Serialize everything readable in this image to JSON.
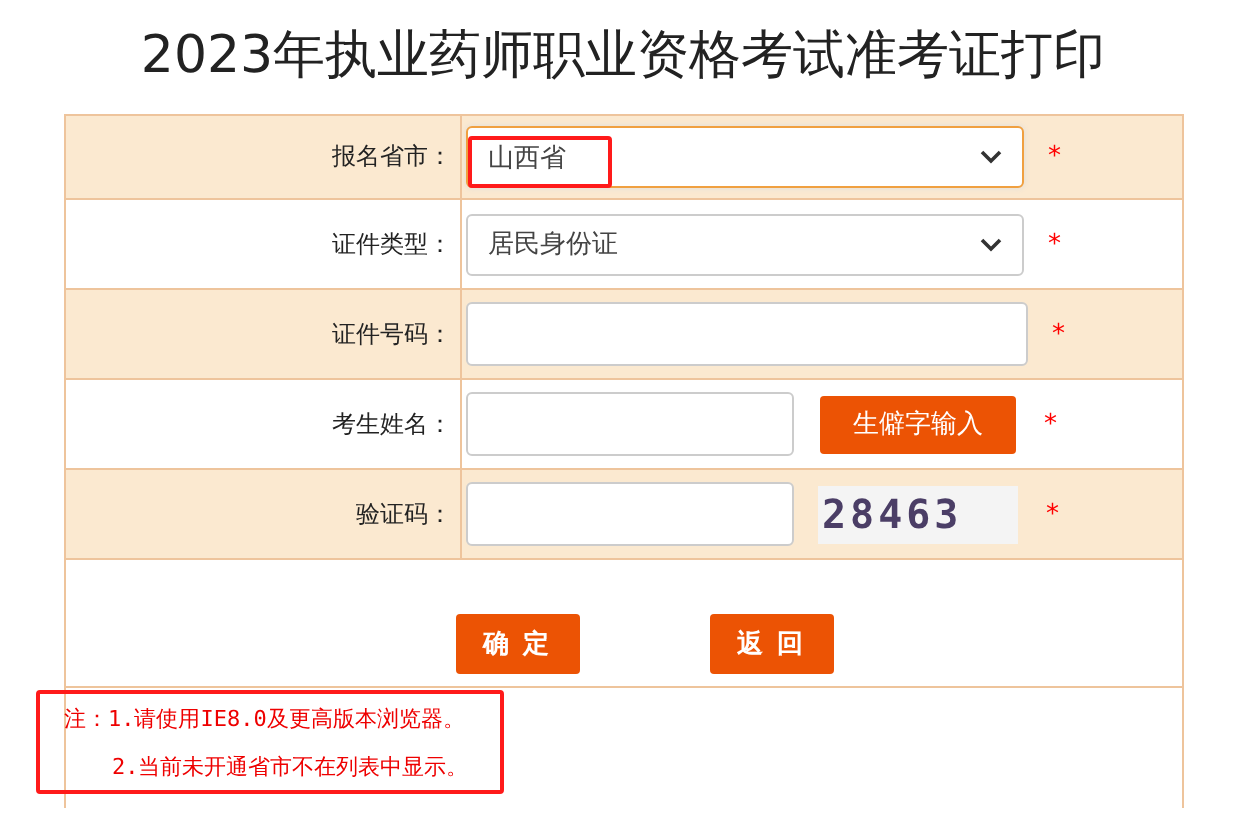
{
  "title": "2023年执业药师职业资格考试准考证打印",
  "rows": [
    {
      "kind": "select",
      "label": "报名省市：",
      "value": "山西省",
      "required": "*",
      "highlighted": true
    },
    {
      "kind": "select",
      "label": "证件类型：",
      "value": "居民身份证",
      "required": "*",
      "highlighted": false
    },
    {
      "kind": "input",
      "label": "证件号码：",
      "required": "*"
    },
    {
      "kind": "name",
      "label": "考生姓名：",
      "button": "生僻字输入",
      "required": "*"
    },
    {
      "kind": "captcha",
      "label": "验证码：",
      "captcha": "28463",
      "required": "*"
    }
  ],
  "buttons": [
    "确 定",
    "返 回"
  ],
  "notes": {
    "highlighted": true,
    "lines": [
      "注：1.请使用IE8.0及更高版本浏览器。",
      "2.当前未开通省市不在列表中显示。"
    ]
  }
}
